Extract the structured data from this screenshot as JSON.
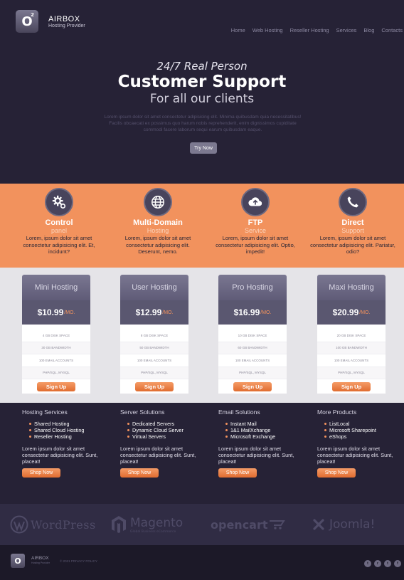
{
  "brand": {
    "logo_letter": "O",
    "logo_sup": "2",
    "name": "AIRBOX",
    "tagline": "Hosting Provider"
  },
  "nav": {
    "items": [
      "Home",
      "Web Hosting",
      "Reseller Hosting",
      "Services",
      "Blog",
      "Contacts"
    ]
  },
  "hero": {
    "line1": "24/7 Real Person",
    "line2": "Customer Support",
    "line3": "For all our clients",
    "body": "Lorem ipsum dolor sit amet consectetur adipisicing elit. Minima quibusdam quia necessitatibus! Facilis obcaecati ex possimus quo harum nobis reprehenderit, enim dignissimos cupiditate commodi facere laborum sequi earum quibusdam eaque.",
    "cta": "Try Now"
  },
  "features": [
    {
      "icon": "gears-icon",
      "title": "Control",
      "sub": "panel",
      "text": "Lorem, ipsum dolor sit amet consectetur adipisicing elit. Et, incidunt?"
    },
    {
      "icon": "globe-icon",
      "title": "Multi-Domain",
      "sub": "Hosting",
      "text": "Lorem, ipsum dolor sit amet consectetur adipisicing elit. Deserunt, nemo."
    },
    {
      "icon": "cloud-upload-icon",
      "title": "FTP",
      "sub": "Service",
      "text": "Lorem, ipsum dolor sit amet consectetur adipisicing elit. Optio, impedit!"
    },
    {
      "icon": "phone-icon",
      "title": "Direct",
      "sub": "Support",
      "text": "Lorem, ipsum dolor sit amet consectetur adipisicing elit. Pariatur, odio?"
    }
  ],
  "plans": [
    {
      "name": "Mini Hosting",
      "price": "$10.99",
      "period": "/MO.",
      "rows": [
        "4 GB DISK SPACE",
        "30 GB BANDWIDTH",
        "100 EMAIL ACCOUNTS",
        "PHP/SQL, MYSQL"
      ],
      "cta": "Sign Up"
    },
    {
      "name": "User Hosting",
      "price": "$12.99",
      "period": "/MO.",
      "rows": [
        "8 GB DISK SPACE",
        "50 GB BANDWIDTH",
        "100 EMAIL ACCOUNTS",
        "PHP/SQL, MYSQL"
      ],
      "cta": "Sign Up"
    },
    {
      "name": "Pro Hosting",
      "price": "$16.99",
      "period": "/MO.",
      "rows": [
        "10 GB DISK SPACE",
        "60 GB BANDWIDTH",
        "100 EMAIL ACCOUNTS",
        "PHP/SQL, MYSQL"
      ],
      "cta": "Sign Up"
    },
    {
      "name": "Maxi Hosting",
      "price": "$20.99",
      "period": "/MO.",
      "rows": [
        "20 GB DISK SPACE",
        "100 GB BANDWIDTH",
        "100 EMAIL ACCOUNTS",
        "PHP/SQL, MYSQL"
      ],
      "cta": "Sign Up"
    }
  ],
  "services": [
    {
      "title": "Hosting Services",
      "items": [
        "Shared Hosting",
        "Shared Cloud Hosting",
        "Reseller Hosting"
      ],
      "text": "Lorem ipsum dolor sit amet consectetur adipisicing elit. Sunt, placeat!",
      "cta": "Shop Now"
    },
    {
      "title": "Server Solutions",
      "items": [
        "Dedicated Servers",
        "Dynamic Cloud Server",
        "Virtual Servers"
      ],
      "text": "Lorem ipsum dolor sit amet consectetur adipisicing elit. Sunt, placeat!",
      "cta": "Shop Now"
    },
    {
      "title": "Email Solutions",
      "items": [
        "Instant Mail",
        "1&1 MailXchange",
        "Microsoft Exchange"
      ],
      "text": "Lorem ipsum dolor sit amet consectetur adipisicing elit. Sunt, placeat!",
      "cta": "Shop Now"
    },
    {
      "title": "More Products",
      "items": [
        "ListLocal",
        "Microsoft Sharepoint",
        "eShops"
      ],
      "text": "Lorem ipsum dolor sit amet consectetur adipisicing elit. Sunt, placeat!",
      "cta": "Shop Now"
    }
  ],
  "partners": [
    {
      "icon": "wordpress-icon",
      "name": "WordPress"
    },
    {
      "icon": "magento-icon",
      "name": "Magento",
      "sub": "Global Business eCommerce"
    },
    {
      "icon": "opencart-icon",
      "name": "opencart"
    },
    {
      "icon": "joomla-icon",
      "name": "Joomla!"
    }
  ],
  "footer": {
    "name": "AIRBOX",
    "sub": "Hosting Provider",
    "copyright": "© 2021 PRIVACY POLICY",
    "social": [
      "twitter-icon",
      "rss-icon",
      "tumblr-icon",
      "facebook-icon"
    ],
    "social_glyphs": [
      "t",
      "r",
      "t",
      "f"
    ]
  },
  "colors": {
    "dark": "#262236",
    "orange": "#f2925d",
    "panel": "#5a5770",
    "light": "#e5e4e8"
  }
}
